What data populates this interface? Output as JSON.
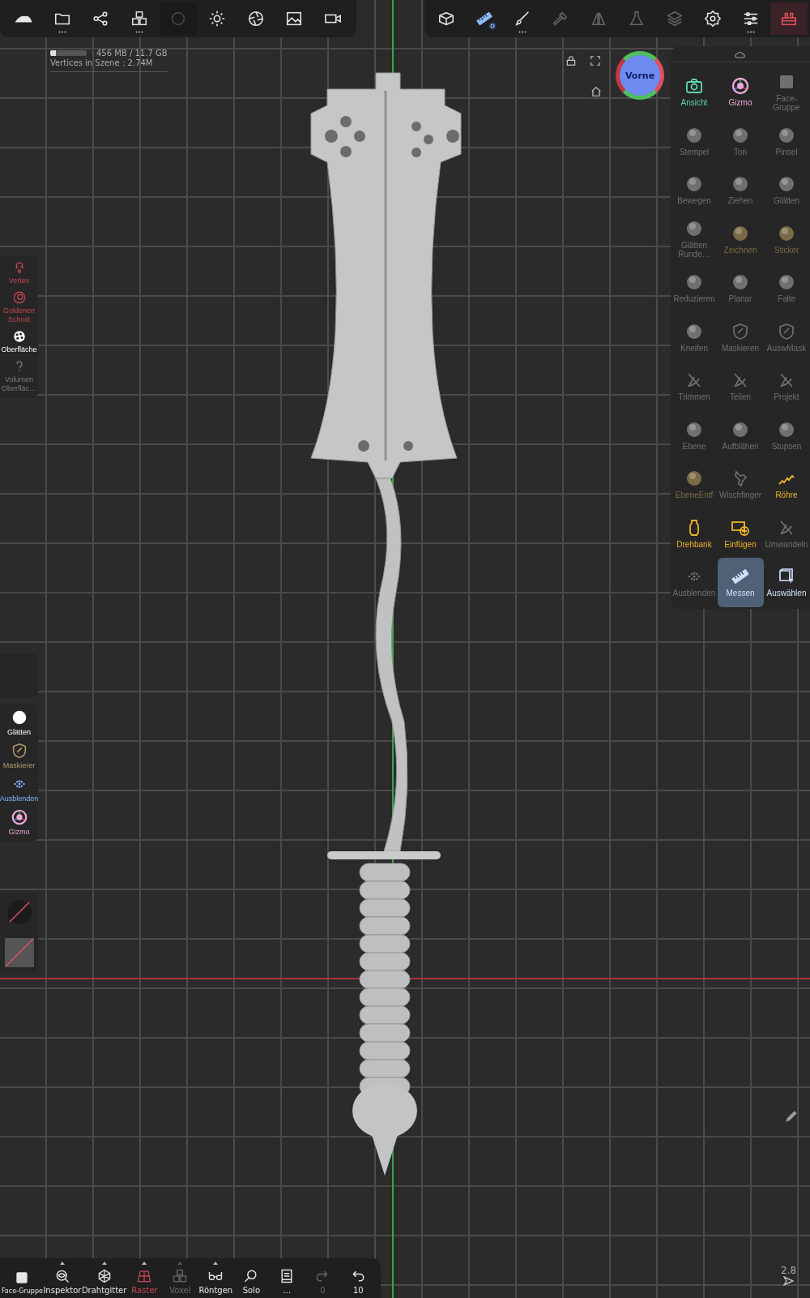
{
  "top_toolbar_left": [
    {
      "disabled": false,
      "more": false
    },
    {
      "disabled": false,
      "more": true
    },
    {
      "disabled": false,
      "more": false
    },
    {
      "disabled": false,
      "more": true
    },
    {
      "disabled": true,
      "more": false
    },
    {
      "disabled": false,
      "more": false
    },
    {
      "disabled": false,
      "more": false
    },
    {
      "disabled": false,
      "more": false
    },
    {
      "disabled": false,
      "more": false
    }
  ],
  "top_toolbar_right": [
    {
      "disabled": false,
      "selected": false,
      "more": false
    },
    {
      "disabled": false,
      "selected": true,
      "more": false
    },
    {
      "disabled": false,
      "selected": false,
      "more": true
    },
    {
      "disabled": true,
      "selected": false,
      "more": false
    },
    {
      "disabled": true,
      "selected": false,
      "more": false
    },
    {
      "disabled": true,
      "selected": false,
      "more": false
    },
    {
      "disabled": true,
      "selected": false,
      "more": false
    },
    {
      "disabled": false,
      "selected": false,
      "more": false
    },
    {
      "disabled": false,
      "selected": false,
      "more": true
    },
    {
      "disabled": false,
      "selected": true,
      "more": false
    }
  ],
  "stats": {
    "memory": "456 MB / 11.7 GB",
    "level": 0.15,
    "vertices": "Vertices in Szene：2.74M"
  },
  "view_cube": {
    "label": "Vorne"
  },
  "tool_panel": [
    {
      "label": "Ansicht",
      "color": "#5fd6b0",
      "selected": false
    },
    {
      "label": "Gizmo",
      "color": "#e9a8d8",
      "selected": false
    },
    {
      "label": "Face-Gruppe",
      "color": "#707070",
      "selected": false
    },
    {
      "label": "Stempel",
      "color": "#707070",
      "selected": false
    },
    {
      "label": "Ton",
      "color": "#707070",
      "selected": false
    },
    {
      "label": "Pinsel",
      "color": "#707070",
      "selected": false
    },
    {
      "label": "Bewegen",
      "color": "#707070",
      "selected": false
    },
    {
      "label": "Ziehen",
      "color": "#707070",
      "selected": false
    },
    {
      "label": "Glätten",
      "color": "#707070",
      "selected": false
    },
    {
      "label": "Glätten Runde…",
      "color": "#707070",
      "selected": false
    },
    {
      "label": "Zeichnen",
      "color": "#7a6a45",
      "selected": false
    },
    {
      "label": "Sticker",
      "color": "#7a6a45",
      "selected": false
    },
    {
      "label": "Reduzieren",
      "color": "#707070",
      "selected": false
    },
    {
      "label": "Planar",
      "color": "#707070",
      "selected": false
    },
    {
      "label": "Falte",
      "color": "#707070",
      "selected": false
    },
    {
      "label": "Kneifen",
      "color": "#707070",
      "selected": false
    },
    {
      "label": "Maskieren",
      "color": "#707070",
      "selected": false
    },
    {
      "label": "AuswMask",
      "color": "#707070",
      "selected": false
    },
    {
      "label": "Trimmen",
      "color": "#707070",
      "selected": false
    },
    {
      "label": "Teilen",
      "color": "#707070",
      "selected": false
    },
    {
      "label": "Projekt",
      "color": "#707070",
      "selected": false
    },
    {
      "label": "Ebene",
      "color": "#707070",
      "selected": false
    },
    {
      "label": "Aufblähen",
      "color": "#707070",
      "selected": false
    },
    {
      "label": "Stupsen",
      "color": "#707070",
      "selected": false
    },
    {
      "label": "EbeneEntf",
      "color": "#7a6a45",
      "selected": false
    },
    {
      "label": "Wischfinger",
      "color": "#707070",
      "selected": false
    },
    {
      "label": "Röhre",
      "color": "#f0b429",
      "selected": false
    },
    {
      "label": "Drehbank",
      "color": "#f0b429",
      "selected": false
    },
    {
      "label": "Einfügen",
      "color": "#f0b429",
      "selected": false
    },
    {
      "label": "Umwandeln",
      "color": "#707070",
      "selected": false
    },
    {
      "label": "Ausblenden",
      "color": "#707070",
      "selected": false
    },
    {
      "label": "Messen",
      "color": "#cfe0ff",
      "selected": true
    },
    {
      "label": "Auswählen",
      "color": "#cfe0ff",
      "selected": false
    }
  ],
  "left_panel": [
    {
      "label": "Vertex",
      "color": "#c0454f"
    },
    {
      "label": "Goldenen Schnitt",
      "color": "#c0454f"
    },
    {
      "label": "Oberfläche",
      "color": "#ffffff"
    },
    {
      "label": "Volumen Oberfläc…",
      "color": "#7a7a7a"
    }
  ],
  "left_tools": [
    {
      "label": "Glätten",
      "color": "#ffffff"
    },
    {
      "label": "Maskierer",
      "color": "#b39a6a"
    },
    {
      "label": "Ausblenden",
      "color": "#7fb7ff"
    },
    {
      "label": "Gizmo",
      "color": "#e9a8d8"
    }
  ],
  "bottom_toolbar": [
    {
      "label": "Face-Gruppe",
      "disabled": false,
      "selected": false,
      "more": false
    },
    {
      "label": "Inspektor",
      "disabled": false,
      "selected": false,
      "more": true
    },
    {
      "label": "Drahtgitter",
      "disabled": false,
      "selected": false,
      "more": true
    },
    {
      "label": "Raster",
      "disabled": false,
      "selected": true,
      "more": true
    },
    {
      "label": "Voxel",
      "disabled": true,
      "selected": false,
      "more": true
    },
    {
      "label": "Röntgen",
      "disabled": false,
      "selected": false,
      "more": true
    },
    {
      "label": "Solo",
      "disabled": false,
      "selected": false,
      "more": false
    },
    {
      "label": "...",
      "disabled": false,
      "selected": false,
      "more": false
    },
    {
      "label": "0",
      "disabled": true,
      "selected": false,
      "more": false
    },
    {
      "label": "10",
      "disabled": false,
      "selected": false,
      "more": false
    }
  ],
  "zoom_readout": "2.8"
}
